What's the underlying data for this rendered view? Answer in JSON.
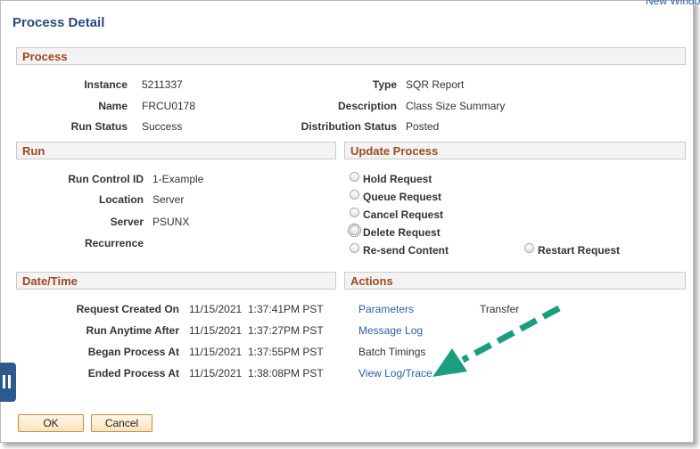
{
  "window": {
    "title": "Process Detail",
    "new_window": "New Window"
  },
  "process": {
    "header": "Process",
    "instance_label": "Instance",
    "instance_value": "5211337",
    "name_label": "Name",
    "name_value": "FRCU0178",
    "run_status_label": "Run Status",
    "run_status_value": "Success",
    "type_label": "Type",
    "type_value": "SQR Report",
    "description_label": "Description",
    "description_value": "Class Size Summary",
    "dist_status_label": "Distribution Status",
    "dist_status_value": "Posted"
  },
  "run": {
    "header": "Run",
    "run_control_label": "Run Control ID",
    "run_control_value": "1-Example",
    "location_label": "Location",
    "location_value": "Server",
    "server_label": "Server",
    "server_value": "PSUNX",
    "recurrence_label": "Recurrence",
    "recurrence_value": ""
  },
  "update_process": {
    "header": "Update Process",
    "options": [
      "Hold Request",
      "Queue Request",
      "Cancel Request",
      "Delete Request",
      "Re-send Content",
      "Restart Request"
    ],
    "focused_option": "Delete Request"
  },
  "datetime": {
    "header": "Date/Time",
    "rows": [
      {
        "label": "Request Created On",
        "date": "11/15/2021",
        "time": "1:37:41PM PST"
      },
      {
        "label": "Run Anytime After",
        "date": "11/15/2021",
        "time": "1:37:27PM PST"
      },
      {
        "label": "Began Process At",
        "date": "11/15/2021",
        "time": "1:37:55PM PST"
      },
      {
        "label": "Ended Process At",
        "date": "11/15/2021",
        "time": "1:38:08PM PST"
      }
    ]
  },
  "actions": {
    "header": "Actions",
    "parameters": "Parameters",
    "transfer": "Transfer",
    "message_log": "Message Log",
    "batch_timings": "Batch Timings",
    "view_log": "View Log/Trace"
  },
  "buttons": {
    "ok": "OK",
    "cancel": "Cancel"
  },
  "annotation": {
    "arrow_color": "#1a9e80"
  },
  "colors": {
    "section_header": "#9b4a1e",
    "link": "#2a5fa8",
    "title": "#2b4a7c",
    "button_border": "#c98a3a"
  }
}
